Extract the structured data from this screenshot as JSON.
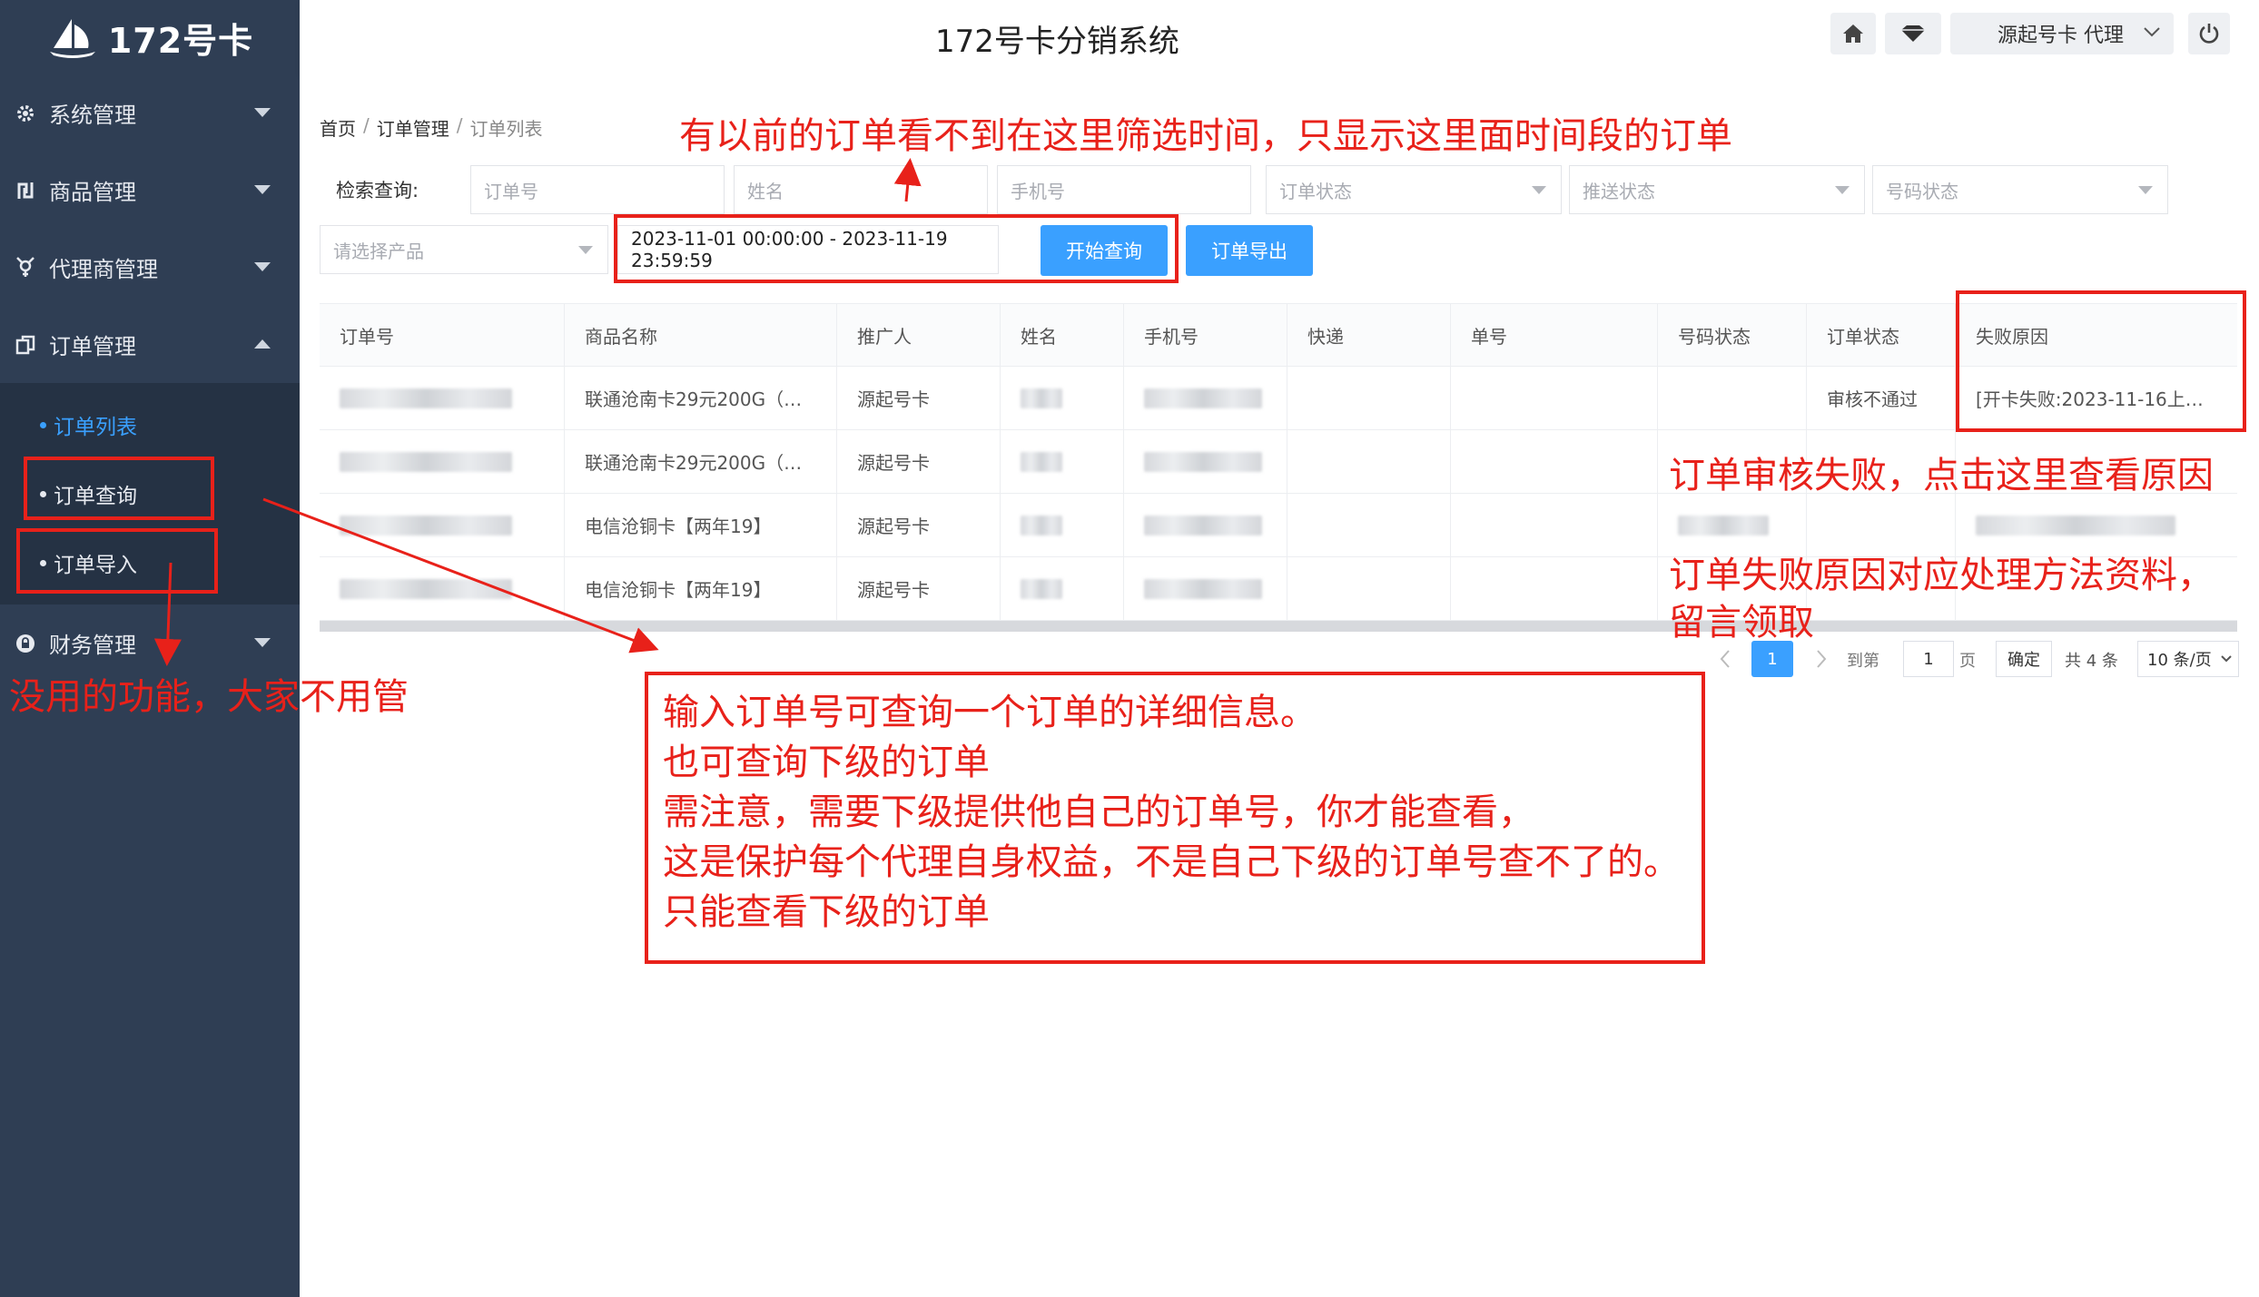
{
  "logo": {
    "text": "172号卡"
  },
  "header": {
    "title": "172号卡分销系统",
    "user": "源起号卡 代理"
  },
  "sidebar": {
    "items": [
      {
        "label": "系统管理"
      },
      {
        "label": "商品管理"
      },
      {
        "label": "代理商管理"
      },
      {
        "label": "订单管理"
      },
      {
        "label": "财务管理"
      }
    ],
    "order_sub": [
      {
        "label": "订单列表"
      },
      {
        "label": "订单查询"
      },
      {
        "label": "订单导入"
      }
    ]
  },
  "breadcrumb": {
    "home": "首页",
    "section": "订单管理",
    "current": "订单列表",
    "sep": "/"
  },
  "filters": {
    "label": "检索查询:",
    "order_no": "订单号",
    "name": "姓名",
    "phone": "手机号",
    "order_status": "订单状态",
    "push_status": "推送状态",
    "number_status": "号码状态",
    "product": "请选择产品",
    "date_range": "2023-11-01 00:00:00 - 2023-11-19 23:59:59",
    "search_btn": "开始查询",
    "export_btn": "订单导出"
  },
  "table": {
    "headers": [
      "订单号",
      "商品名称",
      "推广人",
      "姓名",
      "手机号",
      "快递",
      "单号",
      "号码状态",
      "订单状态",
      "失败原因"
    ],
    "rows": [
      {
        "product": "联通沧南卡29元200G（…",
        "promoter": "源起号卡",
        "order_status": "审核不通过",
        "fail_reason": "[开卡失败:2023-11-16上…"
      },
      {
        "product": "联通沧南卡29元200G（…",
        "promoter": "源起号卡",
        "order_status": "",
        "fail_reason": ""
      },
      {
        "product": "电信沧铜卡【两年19】",
        "promoter": "源起号卡",
        "order_status": "",
        "fail_reason": ""
      },
      {
        "product": "电信沧铜卡【两年19】",
        "promoter": "源起号卡",
        "order_status": "",
        "fail_reason": ""
      }
    ]
  },
  "pagination": {
    "current": "1",
    "goto_label": "到第",
    "goto_value": "1",
    "page_label": "页",
    "confirm": "确定",
    "total": "共 4 条",
    "page_size": "10 条/页"
  },
  "annotations": {
    "top": "有以前的订单看不到在这里筛选时间，只显示这里面时间段的订单",
    "right1": "订单审核失败，点击这里查看原因",
    "right2a": "订单失败原因对应处理方法资料，",
    "right2b": "留言领取",
    "left": "没用的功能，大家不用管",
    "box_lines": [
      "输入订单号可查询一个订单的详细信息。",
      "也可查询下级的订单",
      "需注意，需要下级提供他自己的订单号，你才能查看，",
      "这是保护每个代理自身权益，不是自己下级的订单号查不了的。",
      "只能查看下级的订单"
    ]
  },
  "colors": {
    "sidebar": "#2f3e54",
    "accent": "#3aa0ff",
    "annotation": "#e8211a"
  }
}
